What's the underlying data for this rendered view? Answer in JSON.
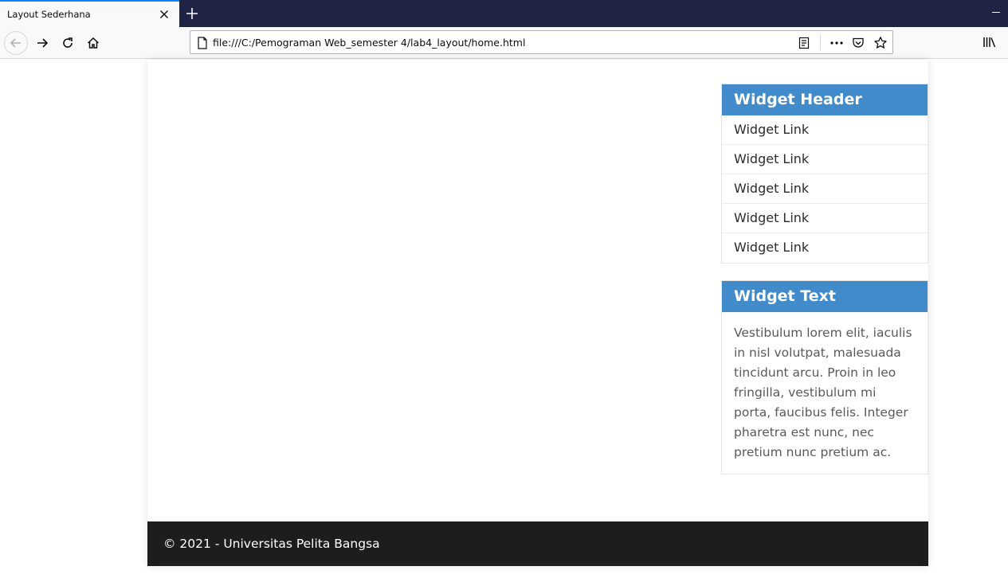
{
  "browser": {
    "tab_title": "Layout Sederhana",
    "url": "file:///C:/Pemograman Web_semester 4/lab4_layout/home.html",
    "icons": [
      "close-icon",
      "plus-icon",
      "back-arrow-icon",
      "forward-arrow-icon",
      "reload-icon",
      "home-icon",
      "page-icon",
      "reader-view-icon",
      "more-icon",
      "pocket-icon",
      "star-icon",
      "library-icon"
    ]
  },
  "sidebar": {
    "links_widget": {
      "header": "Widget Header",
      "links": [
        {
          "label": "Widget Link"
        },
        {
          "label": "Widget Link"
        },
        {
          "label": "Widget Link"
        },
        {
          "label": "Widget Link"
        },
        {
          "label": "Widget Link"
        }
      ]
    },
    "text_widget": {
      "header": "Widget Text",
      "body": "Vestibulum lorem elit, iaculis in nisl volutpat, malesuada tincidunt arcu. Proin in leo fringilla, vestibulum mi porta, faucibus felis. Integer pharetra est nunc, nec pretium nunc pretium ac."
    }
  },
  "footer": {
    "text": "© 2021 - Universitas Pelita Bangsa"
  },
  "colors": {
    "widget_header": "#428bca",
    "footer_bg": "#1d1d1d",
    "tab_accent": "#0a84ff",
    "tabbar_bg": "#1f2444"
  }
}
